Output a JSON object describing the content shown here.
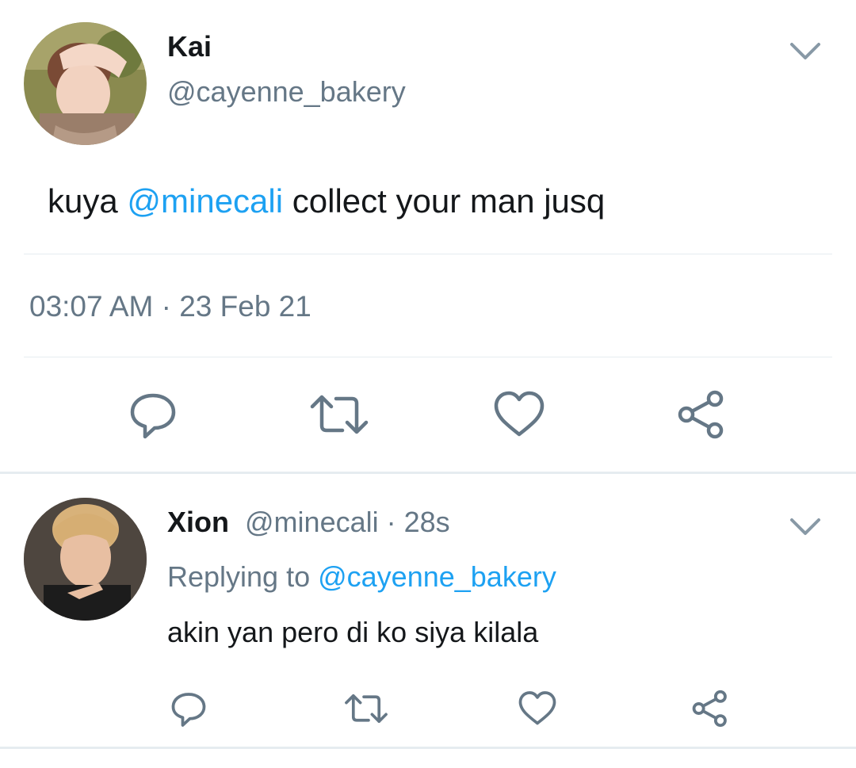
{
  "main_tweet": {
    "author_name": "Kai",
    "author_handle": "@cayenne_bakery",
    "avatar": "avatar-photo",
    "text_prefix": "kuya ",
    "mention": "@minecali",
    "text_suffix": " collect your man jusq",
    "timestamp": "03:07 AM · 23 Feb 21",
    "menu_icon": "chevron-down-icon",
    "actions": [
      "reply-icon",
      "retweet-icon",
      "like-icon",
      "share-icon"
    ]
  },
  "reply_tweet": {
    "author_name": "Xion",
    "author_handle": "@minecali",
    "age": " · 28s",
    "replying_label": "Replying to ",
    "replying_handle": "@cayenne_bakery",
    "text": "akin yan pero di ko siya kilala",
    "avatar": "avatar-photo",
    "menu_icon": "chevron-down-icon",
    "actions": [
      "reply-icon",
      "retweet-icon",
      "like-icon",
      "share-icon"
    ]
  },
  "colors": {
    "icon": "#657786",
    "link": "#1da1f2",
    "text": "#14171a",
    "divider": "#e6ecf0"
  }
}
